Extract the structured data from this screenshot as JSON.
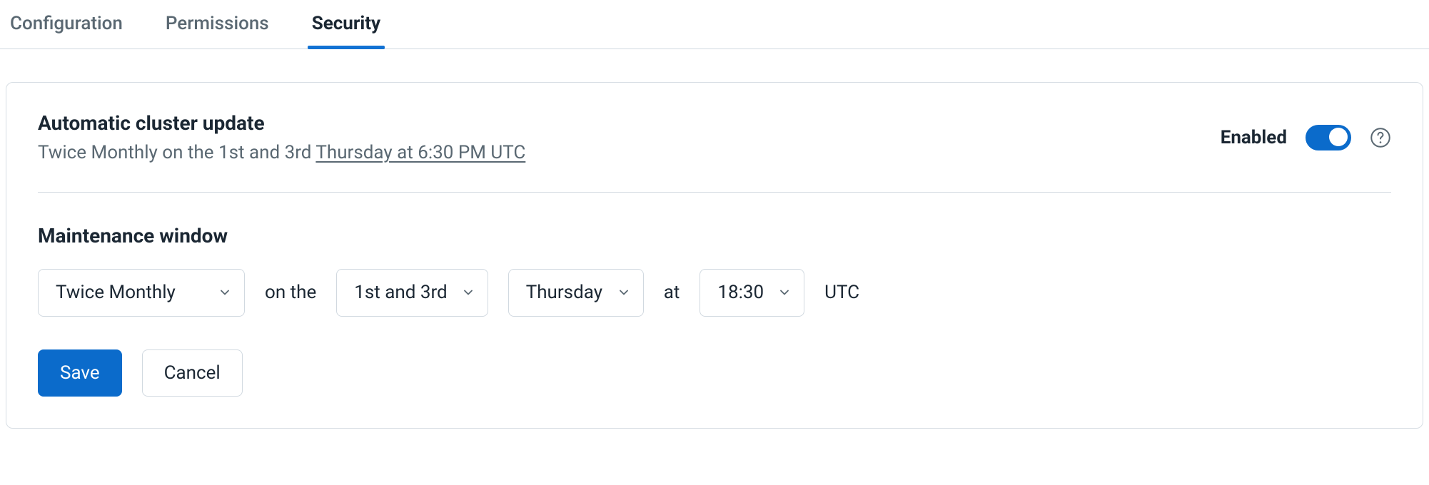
{
  "tabs": {
    "configuration": "Configuration",
    "permissions": "Permissions",
    "security": "Security"
  },
  "security": {
    "title": "Automatic cluster update",
    "subtitle_prefix": "Twice Monthly on the 1st and 3rd ",
    "subtitle_link": "Thursday at 6:30 PM UTC",
    "enabled_label": "Enabled",
    "maintenance": {
      "title": "Maintenance window",
      "frequency": "Twice Monthly",
      "on_the": "on the",
      "occurrence": "1st and 3rd",
      "day": "Thursday",
      "at": "at",
      "time": "18:30",
      "tz": "UTC"
    },
    "actions": {
      "save": "Save",
      "cancel": "Cancel"
    }
  }
}
